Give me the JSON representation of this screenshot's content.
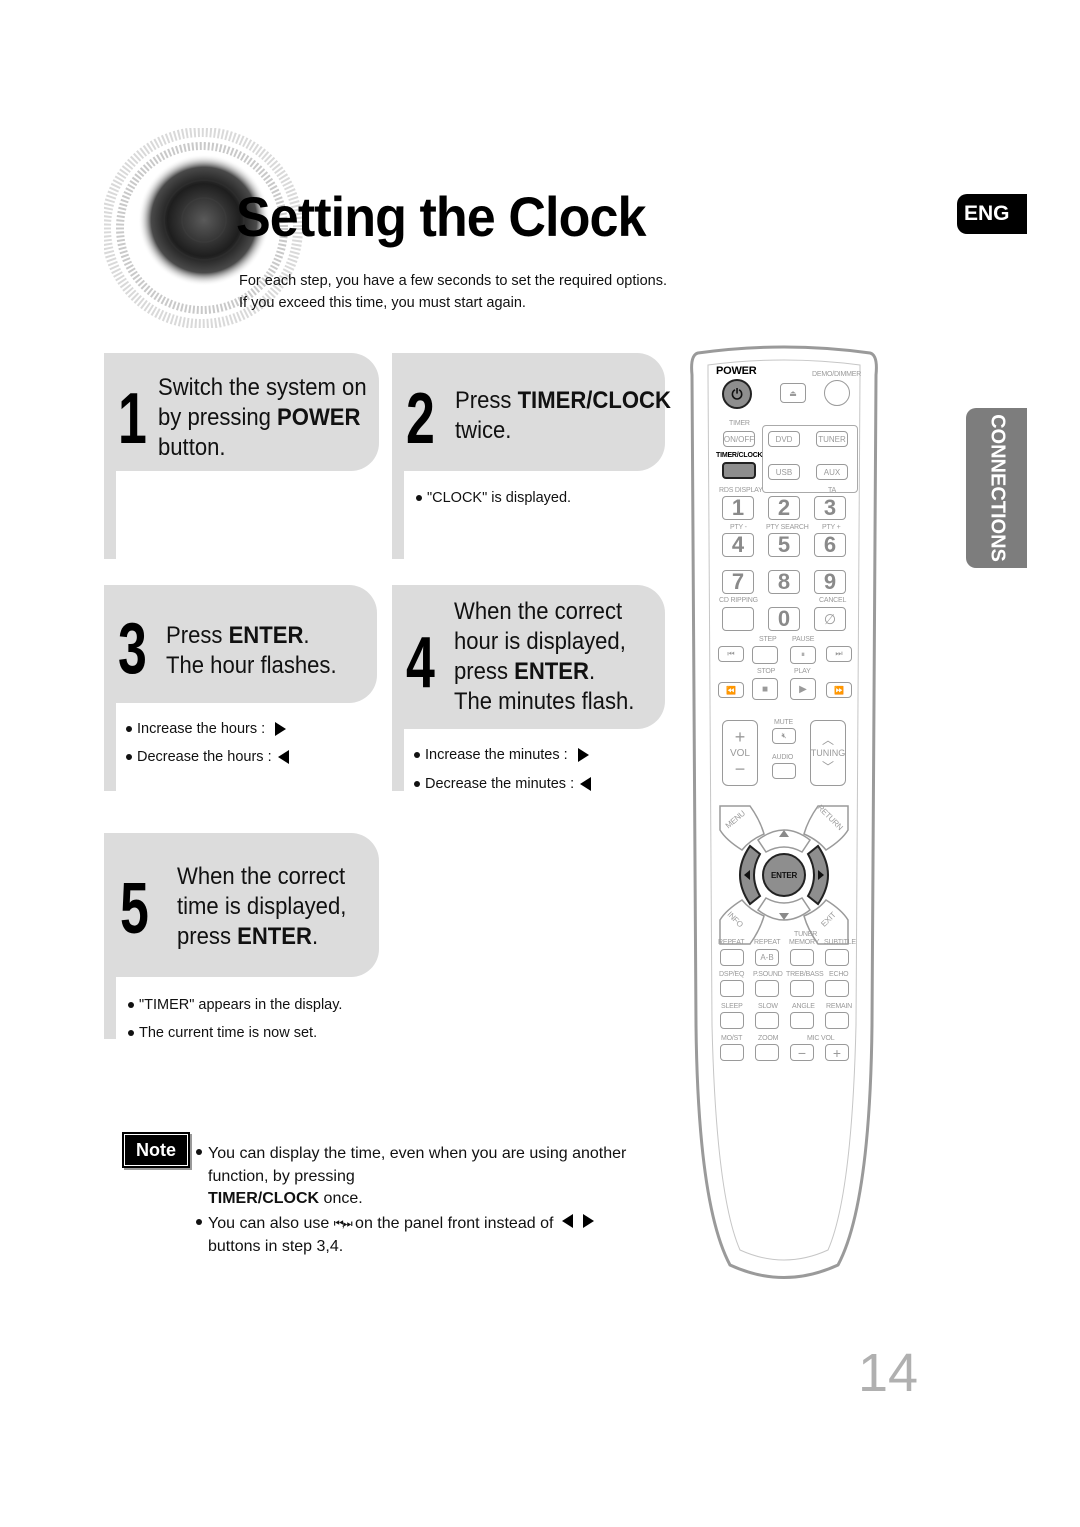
{
  "header": {
    "title": "Setting the Clock",
    "intro_line1": "For each step, you have a few seconds to set the required options.",
    "intro_line2": "If you exceed this time, you must start again.",
    "language_badge": "ENG",
    "section_tab": "CONNECTIONS"
  },
  "steps": [
    {
      "number": "1",
      "text_lines": [
        {
          "pre": "Switch the system on",
          "bold": "",
          "post": ""
        },
        {
          "pre": "by pressing ",
          "bold": "POWER",
          "post": ""
        },
        {
          "pre": "button.",
          "bold": "",
          "post": ""
        }
      ],
      "bullets": []
    },
    {
      "number": "2",
      "text_lines": [
        {
          "pre": "Press ",
          "bold": "TIMER/CLOCK",
          "post": ""
        },
        {
          "pre": "twice.",
          "bold": "",
          "post": ""
        }
      ],
      "bullets": [
        {
          "text": "\"CLOCK\" is displayed.",
          "arrow": ""
        }
      ]
    },
    {
      "number": "3",
      "text_lines": [
        {
          "pre": "Press ",
          "bold": "ENTER",
          "post": "."
        },
        {
          "pre": "The hour flashes.",
          "bold": "",
          "post": ""
        }
      ],
      "bullets": [
        {
          "text": "Increase the hours :",
          "arrow": "right"
        },
        {
          "text": "Decrease the hours :",
          "arrow": "left"
        }
      ]
    },
    {
      "number": "4",
      "text_lines": [
        {
          "pre": "When the correct",
          "bold": "",
          "post": ""
        },
        {
          "pre": "hour is displayed,",
          "bold": "",
          "post": ""
        },
        {
          "pre": "press ",
          "bold": "ENTER",
          "post": "."
        },
        {
          "pre": "The minutes flash.",
          "bold": "",
          "post": ""
        }
      ],
      "bullets": [
        {
          "text": "Increase the minutes :",
          "arrow": "right"
        },
        {
          "text": "Decrease the minutes :",
          "arrow": "left"
        }
      ]
    },
    {
      "number": "5",
      "text_lines": [
        {
          "pre": "When the correct",
          "bold": "",
          "post": ""
        },
        {
          "pre": "time is displayed,",
          "bold": "",
          "post": ""
        },
        {
          "pre": "press ",
          "bold": "ENTER",
          "post": "."
        }
      ],
      "bullets": [
        {
          "text": "\"TIMER\" appears in the display.",
          "arrow": ""
        },
        {
          "text": "The current time is now set.",
          "arrow": ""
        }
      ]
    }
  ],
  "note": {
    "label": "Note",
    "item1_line1": "You can display the time, even when you are using another",
    "item1_line2": "function, by pressing",
    "item1_line3_bold": "TIMER/CLOCK",
    "item1_line3_rest": " once.",
    "item2_pre": "You can also use ",
    "item2_icons": "⏮,⏭",
    "item2_mid": " on the panel front instead of ",
    "item2_line2": "buttons in step 3,4."
  },
  "remote": {
    "labels": {
      "power": "POWER",
      "demo_dimmer": "DEMO/DIMMER",
      "timer": "TIMER",
      "on_off": "ON/OFF",
      "dvd": "DVD",
      "tuner": "TUNER",
      "timer_clock": "TIMER/CLOCK",
      "usb": "USB",
      "aux": "AUX",
      "rds_display": "RDS DISPLAY",
      "ta": "TA",
      "pty_minus": "PTY -",
      "pty_search": "PTY SEARCH",
      "pty_plus": "PTY +",
      "cd_ripping": "CD RIPPING",
      "cancel": "CANCEL",
      "step": "STEP",
      "pause": "PAUSE",
      "stop": "STOP",
      "play": "PLAY",
      "mute": "MUTE",
      "vol": "VOL",
      "audio": "AUDIO",
      "tuning": "TUNING",
      "menu": "MENU",
      "return": "RETURN",
      "enter": "ENTER",
      "info": "INFO",
      "exit": "EXIT",
      "repeat": "REPEAT",
      "repeat_ab": "REPEAT",
      "ab": "A-B",
      "tuner_memory": "TUNER MEMORY",
      "subtitle": "SUBTITLE",
      "dsp_eq": "DSP/EQ",
      "p_sound": "P.SOUND",
      "treb_bass": "TREB/BASS",
      "echo": "ECHO",
      "sleep": "SLEEP",
      "slow": "SLOW",
      "angle": "ANGLE",
      "remain": "REMAIN",
      "mo_st": "MO/ST",
      "zoom": "ZOOM",
      "mic_vol": "MIC VOL"
    },
    "digits": [
      "1",
      "2",
      "3",
      "4",
      "5",
      "6",
      "7",
      "8",
      "9",
      "0"
    ]
  },
  "page_number": "14"
}
